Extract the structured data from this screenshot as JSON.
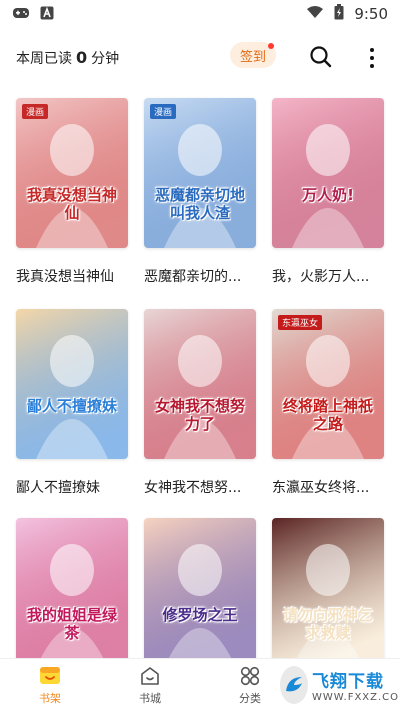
{
  "status_bar": {
    "time": "9:50",
    "icons": [
      "gamepad-icon",
      "a-icon",
      "wifi-icon",
      "battery-charging-icon"
    ]
  },
  "header": {
    "reading_prefix": "本周已读",
    "reading_minutes": "0",
    "reading_unit": "分钟",
    "checkin_label": "签到",
    "icons": [
      "search-icon",
      "more-vertical-icon"
    ]
  },
  "books": [
    {
      "title": "我真没想当神仙",
      "cover_text": "我真没想当神仙",
      "cover_tag": "漫画",
      "colors": [
        "#f3c7c7",
        "#c62828"
      ]
    },
    {
      "title": "恶魔都亲切的...",
      "cover_text": "恶魔都亲切地叫我人渣",
      "cover_tag": "漫画",
      "colors": [
        "#c9dcf3",
        "#2a6bbf"
      ]
    },
    {
      "title": "我，火影万人...",
      "cover_text": "万人奶!",
      "cover_tag": "",
      "colors": [
        "#f4b6c8",
        "#b21e4a"
      ]
    },
    {
      "title": "鄙人不擅撩妹",
      "cover_text": "鄙人不擅撩妹",
      "cover_tag": "",
      "colors": [
        "#f5d7a8",
        "#2c7fd8"
      ]
    },
    {
      "title": "女神我不想努...",
      "cover_text": "女神我不想努力了",
      "cover_tag": "",
      "colors": [
        "#e8d6d6",
        "#b7182f"
      ]
    },
    {
      "title": "东瀛巫女终将...",
      "cover_text": "终将踏上神祇之路",
      "cover_tag": "东瀛巫女",
      "colors": [
        "#e2dcd4",
        "#c41b1b"
      ]
    },
    {
      "title": "",
      "cover_text": "我的姐姐是绿茶",
      "cover_tag": "",
      "colors": [
        "#f3c3df",
        "#c2185b"
      ]
    },
    {
      "title": "",
      "cover_text": "修罗场之王",
      "cover_tag": "",
      "colors": [
        "#f7d3c0",
        "#4a2c8a"
      ]
    },
    {
      "title": "",
      "cover_text": "请勿向邪神乞求救赎",
      "cover_tag": "",
      "colors": [
        "#5a2424",
        "#f4e1c1"
      ]
    }
  ],
  "bottom_nav": [
    {
      "label": "书架",
      "icon": "bookshelf-icon",
      "active": true
    },
    {
      "label": "书城",
      "icon": "bookstore-icon",
      "active": false
    },
    {
      "label": "分类",
      "icon": "category-icon",
      "active": false
    },
    {
      "label": "",
      "icon": "profile-icon",
      "active": false
    }
  ],
  "watermark": {
    "main": "飞翔下载",
    "sub": "WWW.FXXZ.COM"
  },
  "accent_color": "#f08a24"
}
